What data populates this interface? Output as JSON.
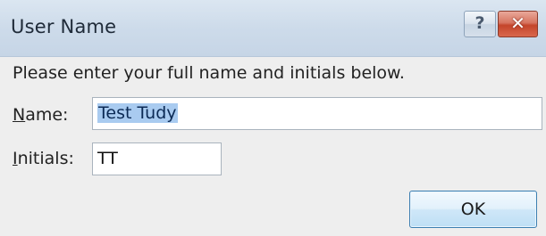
{
  "window": {
    "title": "User Name",
    "help_button": "?",
    "close_button": "x"
  },
  "dialog": {
    "instruction": "Please enter your full name and initials below.",
    "name": {
      "label_accel": "N",
      "label_rest": "ame:",
      "value": "Test Tudy"
    },
    "initials": {
      "label_accel": "I",
      "label_rest": "nitials:",
      "value": "TT"
    },
    "ok_label": "OK"
  }
}
